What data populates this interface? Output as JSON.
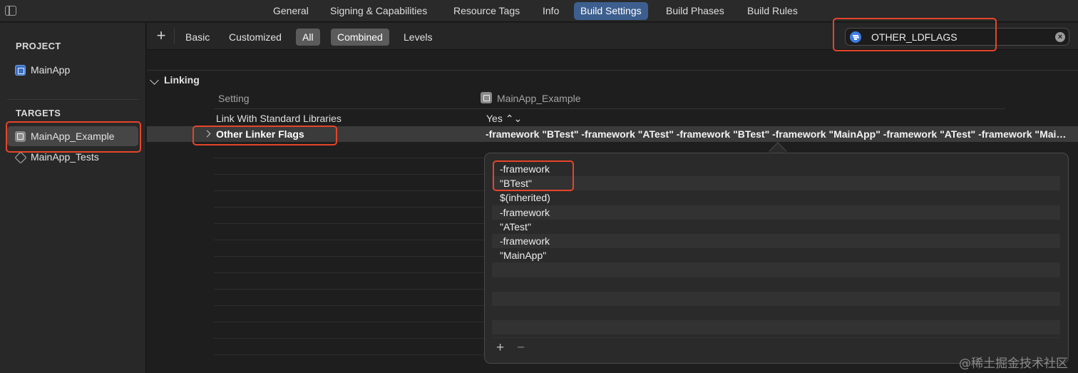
{
  "tabs": [
    {
      "label": "General",
      "active": false
    },
    {
      "label": "Signing & Capabilities",
      "active": false
    },
    {
      "label": "Resource Tags",
      "active": false
    },
    {
      "label": "Info",
      "active": false
    },
    {
      "label": "Build Settings",
      "active": true
    },
    {
      "label": "Build Phases",
      "active": false
    },
    {
      "label": "Build Rules",
      "active": false
    }
  ],
  "sidebar": {
    "project_header": "PROJECT",
    "project_item": "MainApp",
    "targets_header": "TARGETS",
    "targets": [
      {
        "label": "MainApp_Example",
        "selected": true,
        "icon": "target-app-icon"
      },
      {
        "label": "MainApp_Tests",
        "selected": false,
        "icon": "test-bundle-icon"
      }
    ]
  },
  "scopebar": {
    "add_label": "+",
    "filters": [
      "Basic",
      "Customized",
      "All",
      "Combined",
      "Levels"
    ],
    "selected_filters": [
      "All",
      "Combined"
    ]
  },
  "search": {
    "value": "OTHER_LDFLAGS",
    "clear_icon": "×"
  },
  "settings": {
    "section_title": "Linking",
    "column_setting": "Setting",
    "column_target": "MainApp_Example",
    "rows": [
      {
        "name": "Link With Standard Libraries",
        "value": "Yes ⌃⌄"
      },
      {
        "name": "Other Linker Flags",
        "value": "-framework \"BTest\"  -framework \"ATest\" -framework \"BTest\" -framework \"MainApp\" -framework \"ATest\" -framework \"MainApp\""
      }
    ]
  },
  "popover": {
    "items": [
      "-framework",
      "\"BTest\"",
      "$(inherited)",
      "-framework",
      "\"ATest\"",
      "-framework",
      "\"MainApp\""
    ],
    "add_label": "+",
    "remove_label": "−"
  },
  "watermark": "@稀土掘金技术社区",
  "colors": {
    "accent_tab": "#3d5f8f",
    "highlight_box": "#e5452a",
    "filter_icon": "#3b7de3"
  }
}
